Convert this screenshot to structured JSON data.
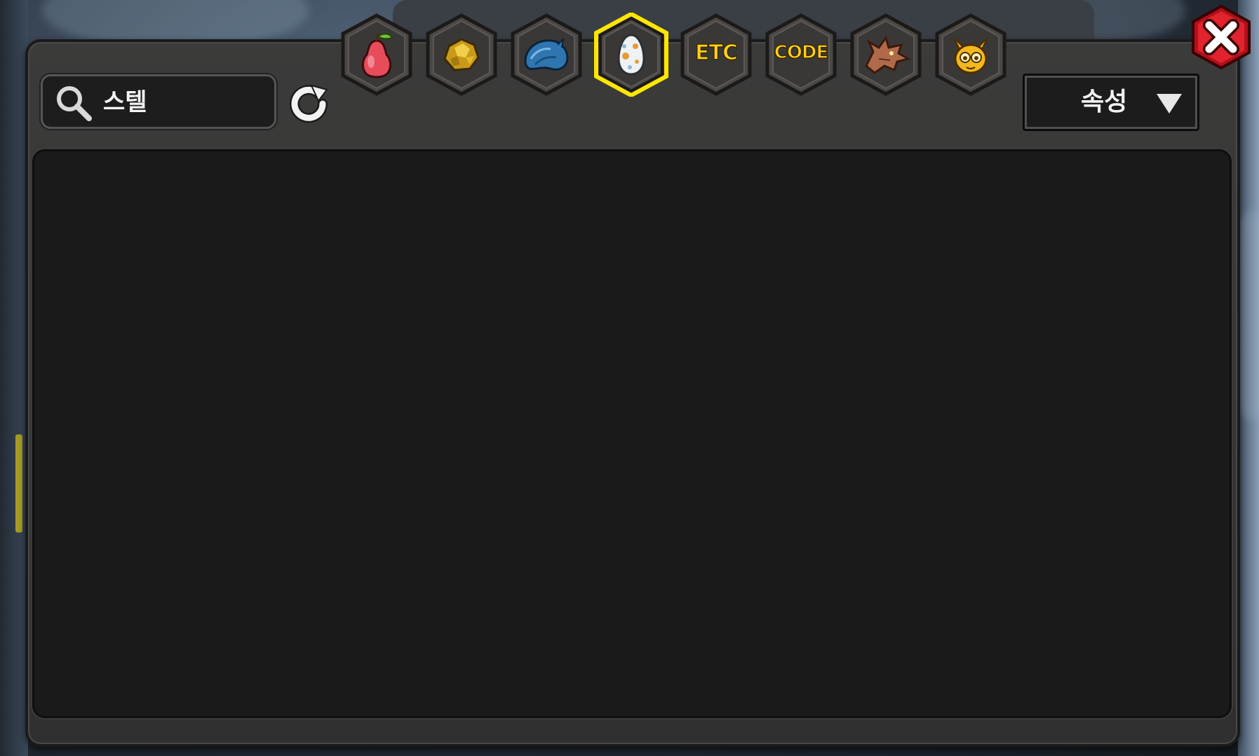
{
  "search": {
    "value": "스텔"
  },
  "tabs": [
    {
      "name": "fruit",
      "label": "",
      "icon": "pear-fruit-icon",
      "selected": false
    },
    {
      "name": "gold",
      "label": "",
      "icon": "gold-nugget-icon",
      "selected": false
    },
    {
      "name": "scale",
      "label": "",
      "icon": "blue-dragon-scale-icon",
      "selected": false
    },
    {
      "name": "egg",
      "label": "",
      "icon": "egg-icon",
      "selected": true
    },
    {
      "name": "etc",
      "label": "ETC",
      "icon": "",
      "selected": false
    },
    {
      "name": "code",
      "label": "CODE",
      "icon": "",
      "selected": false
    },
    {
      "name": "dragon",
      "label": "",
      "icon": "dragon-head-icon",
      "selected": false
    },
    {
      "name": "pet",
      "label": "",
      "icon": "horned-creature-icon",
      "selected": false
    }
  ],
  "attribute_dropdown": {
    "label": "속성"
  },
  "colors": {
    "selected_glow": "#ffe600",
    "tab_text": "#ffd21a",
    "close_red": "#d81a23",
    "panel": "#333333",
    "content": "#1a1a1a"
  }
}
